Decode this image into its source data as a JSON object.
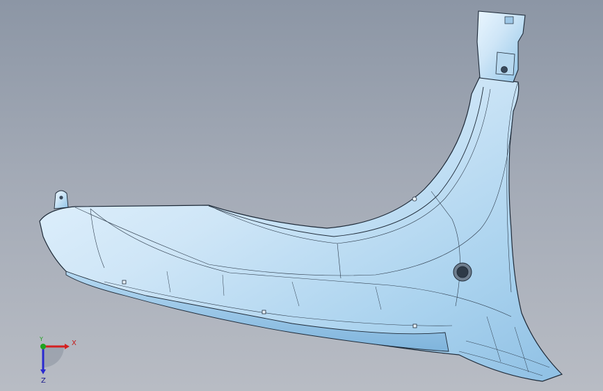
{
  "viewport": {
    "background_top": "#8c96a5",
    "background_bottom": "#b8bcc4"
  },
  "model": {
    "part_color": "#cfe6f7",
    "part_shadow": "#8fc0e4",
    "edge_color": "#1e2a38"
  },
  "triad": {
    "x_label": "X",
    "y_label": "Y",
    "z_label": "Z",
    "x_color": "#d42020",
    "y_color": "#1fa31f",
    "z_color": "#2a2ad0"
  }
}
